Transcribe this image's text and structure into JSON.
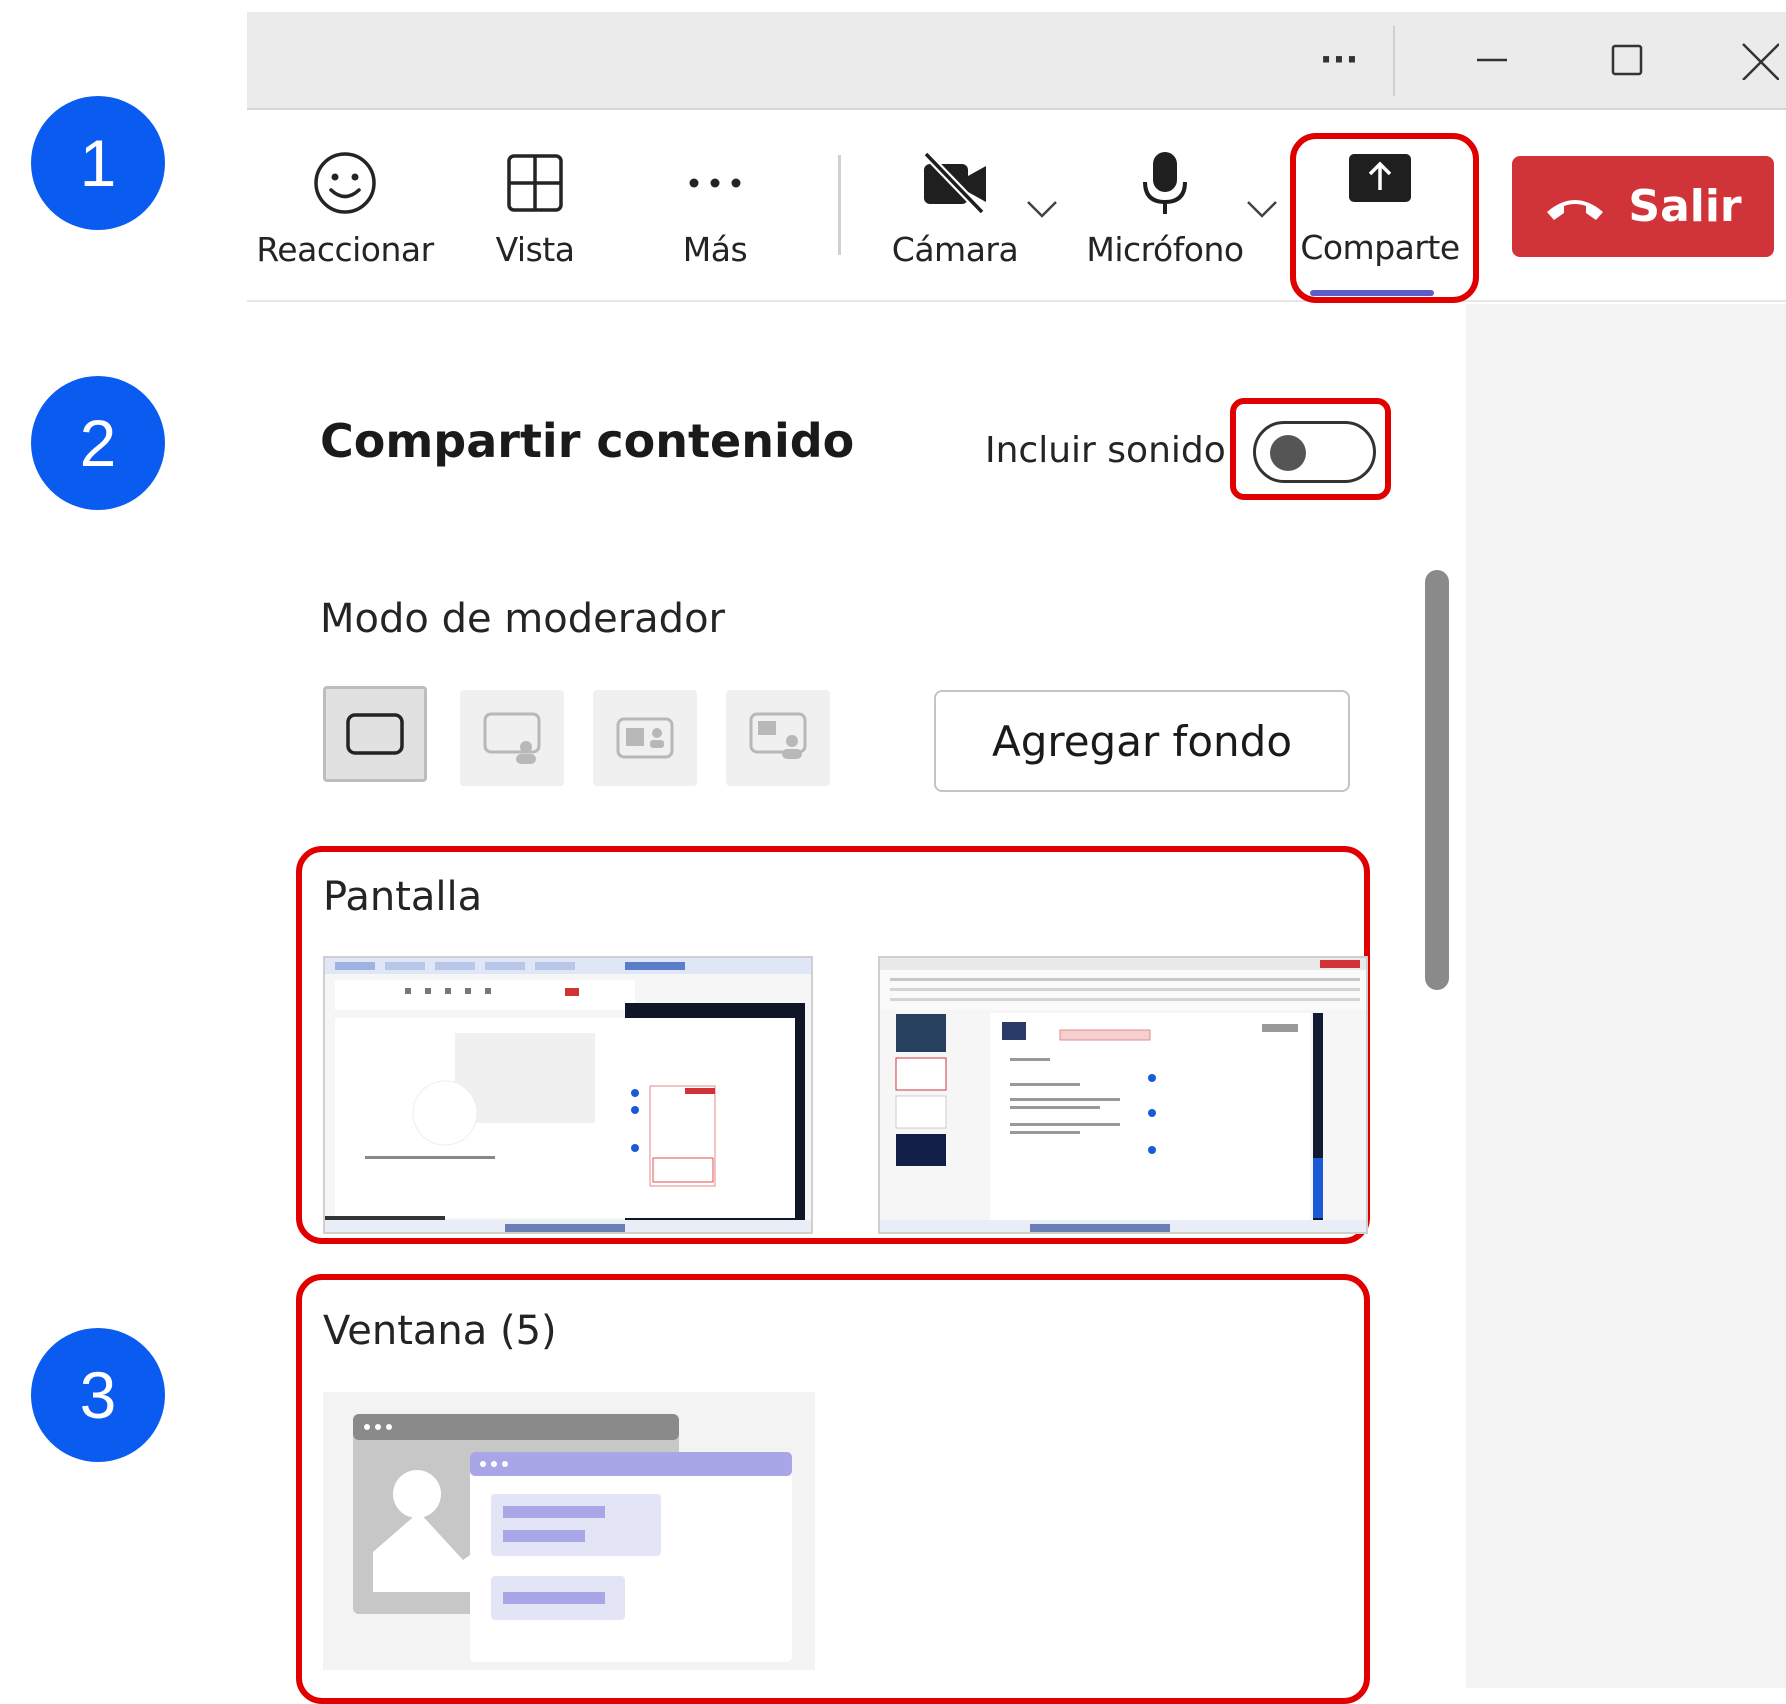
{
  "steps": [
    "1",
    "2",
    "3"
  ],
  "titlebar": {
    "more": "···"
  },
  "toolbar": {
    "react": "Reaccionar",
    "view": "Vista",
    "more": "Más",
    "camera": "Cámara",
    "mic": "Micrófono",
    "share": "Comparte",
    "leave": "Salir"
  },
  "share_panel": {
    "title": "Compartir contenido",
    "include_sound": "Incluir sonido",
    "include_sound_on": false,
    "presenter_mode": "Modo de moderador",
    "add_background": "Agregar fondo",
    "screen_label": "Pantalla",
    "window_label": "Ventana (5)"
  },
  "colors": {
    "badge": "#0a5cf0",
    "leave": "#d13438",
    "highlight": "#e00000",
    "accent": "#5b5fc7"
  }
}
